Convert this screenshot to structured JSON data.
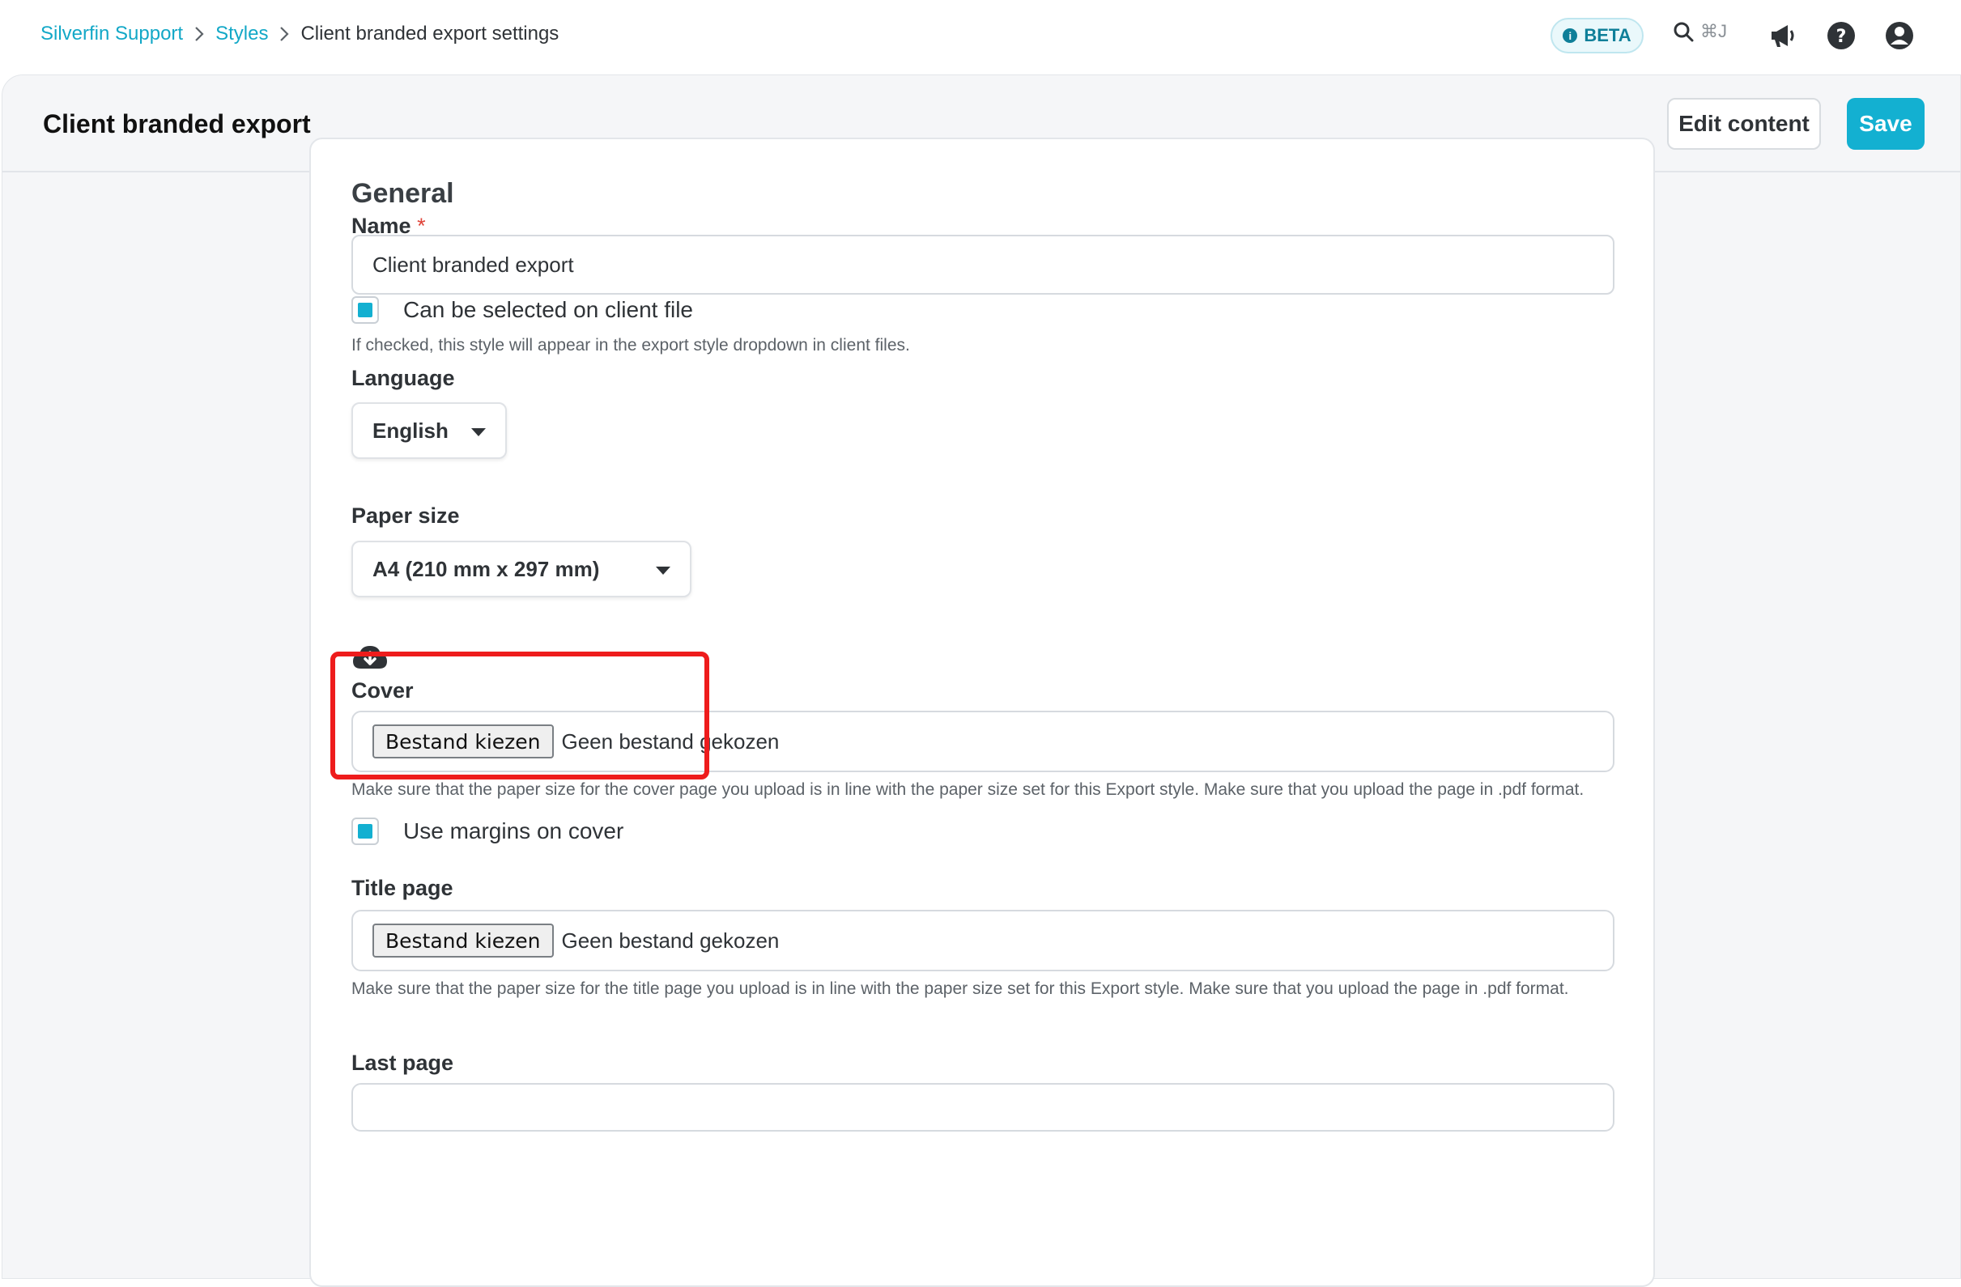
{
  "breadcrumb": {
    "items": [
      "Silverfin Support",
      "Styles"
    ],
    "current": "Client branded export settings"
  },
  "topnav": {
    "beta_label": "BETA",
    "search_shortcut": "⌘J",
    "icons": [
      "search-icon",
      "megaphone-icon",
      "help-icon",
      "user-icon"
    ]
  },
  "header": {
    "title": "Client branded export",
    "edit_label": "Edit content",
    "save_label": "Save"
  },
  "colors": {
    "accent": "#13b0d1",
    "link": "#13a8c7",
    "highlight": "#ee1c1c"
  },
  "general": {
    "section_title": "General",
    "name_label": "Name",
    "name_required": "*",
    "name_value": "Client branded export",
    "client_file_checkbox": {
      "label": "Can be selected on client file",
      "checked": true,
      "help": "If checked, this style will appear in the export style dropdown in client files."
    },
    "language_label": "Language",
    "language_value": "English",
    "paper_size_label": "Paper size",
    "paper_size_value": "A4 (210 mm x 297 mm)",
    "cover": {
      "icon": "cloud-download-icon",
      "label": "Cover",
      "choose_file_label": "Bestand kiezen",
      "no_file_label": "Geen bestand gekozen",
      "help": "Make sure that the paper size for the cover page you upload is in line with the paper size set for this Export style. Make sure that you upload the page in .pdf format."
    },
    "margins_checkbox": {
      "label": "Use margins on cover",
      "checked": true
    },
    "title_page": {
      "label": "Title page",
      "choose_file_label": "Bestand kiezen",
      "no_file_label": "Geen bestand gekozen",
      "help": "Make sure that the paper size for the title page you upload is in line with the paper size set for this Export style. Make sure that you upload the page in .pdf format."
    },
    "last_page": {
      "label": "Last page"
    }
  }
}
